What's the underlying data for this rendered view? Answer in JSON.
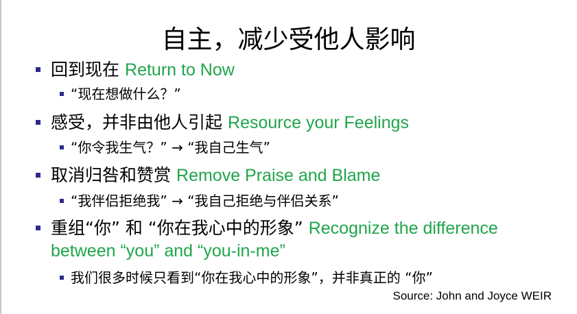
{
  "slide": {
    "title": "自主，减少受他人影响",
    "items": [
      {
        "zh": "回到现在",
        "en": "Return to Now",
        "sub": "“现在想做什么？”"
      },
      {
        "zh": "感受，并非由他人引起",
        "en": "Resource your Feelings",
        "sub": "“你令我生气？” → “我自己生气”"
      },
      {
        "zh": "取消归咎和赞赏",
        "en": "Remove Praise and Blame",
        "sub": "“我伴侣拒绝我” → “我自己拒绝与伴侣关系”"
      },
      {
        "zh": "重组“你” 和 “你在我心中的形象”",
        "en": "Recognize the difference",
        "en2": "between “you” and “you-in-me”",
        "sub": "我们很多时候只看到“你在我心中的形象”，并非真正的 “你”"
      }
    ],
    "source": "Source: John and Joyce WEIR",
    "colors": {
      "bullet": "#2b2b8c",
      "english": "#1fa54a"
    }
  }
}
